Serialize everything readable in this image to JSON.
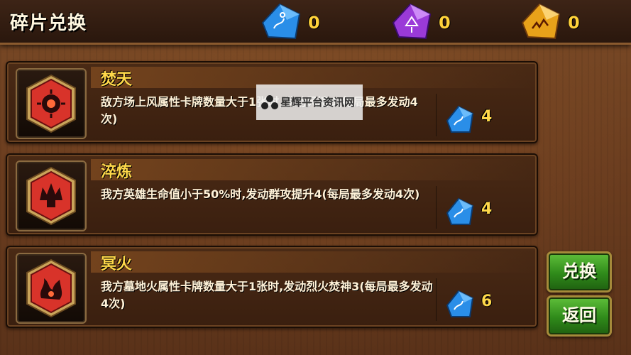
{
  "header": {
    "title": "碎片兑换",
    "resources": [
      {
        "name": "blue-shard-icon",
        "count": "0",
        "color": "#2a8ee8"
      },
      {
        "name": "purple-shard-icon",
        "count": "0",
        "color": "#9a3ad8"
      },
      {
        "name": "gold-shard-icon",
        "count": "0",
        "color": "#e8a21a"
      }
    ]
  },
  "rows": [
    {
      "name": "焚天",
      "desc": "敌方场上风属性卡牌数量大于1张时,发动风墙5(每局最多发动4次)",
      "cost": "4",
      "emblem": "burning-sun-emblem-icon"
    },
    {
      "name": "淬炼",
      "desc": "我方英雄生命值小于50%时,发动群攻提升4(每局最多发动4次)",
      "cost": "4",
      "emblem": "flame-crown-emblem-icon"
    },
    {
      "name": "冥火",
      "desc": "我方墓地火属性卡牌数量大于1张时,发动烈火焚神3(每局最多发动4次)",
      "cost": "6",
      "emblem": "dark-fire-emblem-icon"
    }
  ],
  "buttons": {
    "exchange": "兑换",
    "back": "返回"
  },
  "watermark": "星辉平台资讯网"
}
